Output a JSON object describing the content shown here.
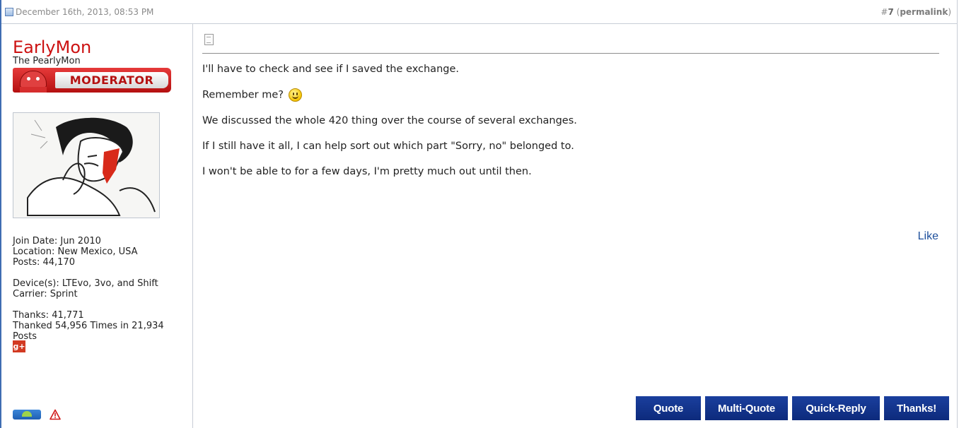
{
  "header": {
    "date": "December 16th, 2013, 08:53 PM",
    "post_number_prefix": "#",
    "post_number": "7",
    "permalink_open": " (",
    "permalink_label": "permalink",
    "permalink_close": ")"
  },
  "user": {
    "name": "EarlyMon",
    "title": "The PearlyMon",
    "badge_label": "MODERATOR",
    "join_date": "Join Date: Jun 2010",
    "location": "Location: New Mexico, USA",
    "posts": "Posts: 44,170",
    "devices": "Device(s): LTEvo, 3vo, and Shift",
    "carrier": "Carrier: Sprint",
    "thanks": "Thanks: 41,771",
    "thanked": "Thanked 54,956 Times in 21,934 Posts",
    "gplus_icon": "g+"
  },
  "message": {
    "line1": "I'll have to check and see if I saved the exchange.",
    "line2": "Remember me?",
    "line3": "We discussed the whole 420 thing over the course of several exchanges.",
    "line4": "If I still have it all, I can help sort out which part \"Sorry, no\" belonged to.",
    "line5": "I won't be able to for a few days, I'm pretty much out until then."
  },
  "like_label": "Like",
  "actions": {
    "quote": "Quote",
    "multi_quote": "Multi-Quote",
    "quick_reply": "Quick-Reply",
    "thanks": "Thanks!"
  },
  "colors": {
    "username": "#cc1111",
    "button_bg": "#12338c",
    "link": "#1d4f9c"
  }
}
